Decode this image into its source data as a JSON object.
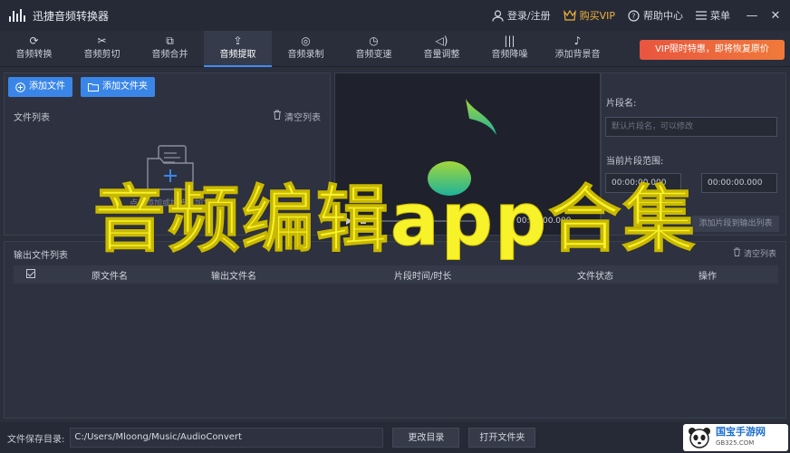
{
  "app": {
    "title": "迅捷音频转换器"
  },
  "topbar": {
    "login": "登录/注册",
    "vip": "购买VIP",
    "help": "帮助中心",
    "menu": "菜单",
    "minimize": "—",
    "close": "✕"
  },
  "toolbar": {
    "tabs": [
      {
        "label": "音频转换",
        "icon": "refresh-icon"
      },
      {
        "label": "音频剪切",
        "icon": "scissors-icon"
      },
      {
        "label": "音频合并",
        "icon": "merge-icon"
      },
      {
        "label": "音频提取",
        "icon": "extract-icon",
        "active": true
      },
      {
        "label": "音频录制",
        "icon": "microphone-icon"
      },
      {
        "label": "音频变速",
        "icon": "speed-icon"
      },
      {
        "label": "音量调整",
        "icon": "volume-icon"
      },
      {
        "label": "音频降噪",
        "icon": "denoise-icon"
      },
      {
        "label": "添加背景音",
        "icon": "music-note-icon"
      }
    ],
    "vip_banner": "VIP限时特惠，即将恢复原价"
  },
  "files": {
    "add_file": "添加文件",
    "add_folder": "添加文件夹",
    "list_label": "文件列表",
    "clear_list": "清空列表",
    "hint": "点击添加或拖拽添加文件"
  },
  "player": {
    "time_start": "00:00:00.000",
    "time_end": "00:00:00.000"
  },
  "segment": {
    "name_label": "片段名:",
    "name_placeholder": "默认片段名，可以修改",
    "range_label": "当前片段范围:",
    "start": "00:00:00.000",
    "end": "00:00:00.000",
    "add_button": "添加片段到输出列表"
  },
  "output": {
    "label": "输出文件列表",
    "clear": "清空列表",
    "columns": [
      "原文件名",
      "输出文件名",
      "片段时间/时长",
      "文件状态",
      "操作"
    ]
  },
  "bottom": {
    "save_label": "文件保存目录:",
    "save_path": "C:/Users/Mloong/Music/AudioConvert",
    "change_dir": "更改目录",
    "open_folder": "打开文件夹"
  },
  "watermark": {
    "name": "国宝手游网",
    "url": "GB325.COM"
  },
  "overlay_caption": "音频编辑app合集",
  "colors": {
    "accent": "#3a86e8",
    "vip": "#f0b23a",
    "caption": "#f7f22a",
    "note_top": "#9fd23b",
    "note_bottom": "#22b59a"
  }
}
